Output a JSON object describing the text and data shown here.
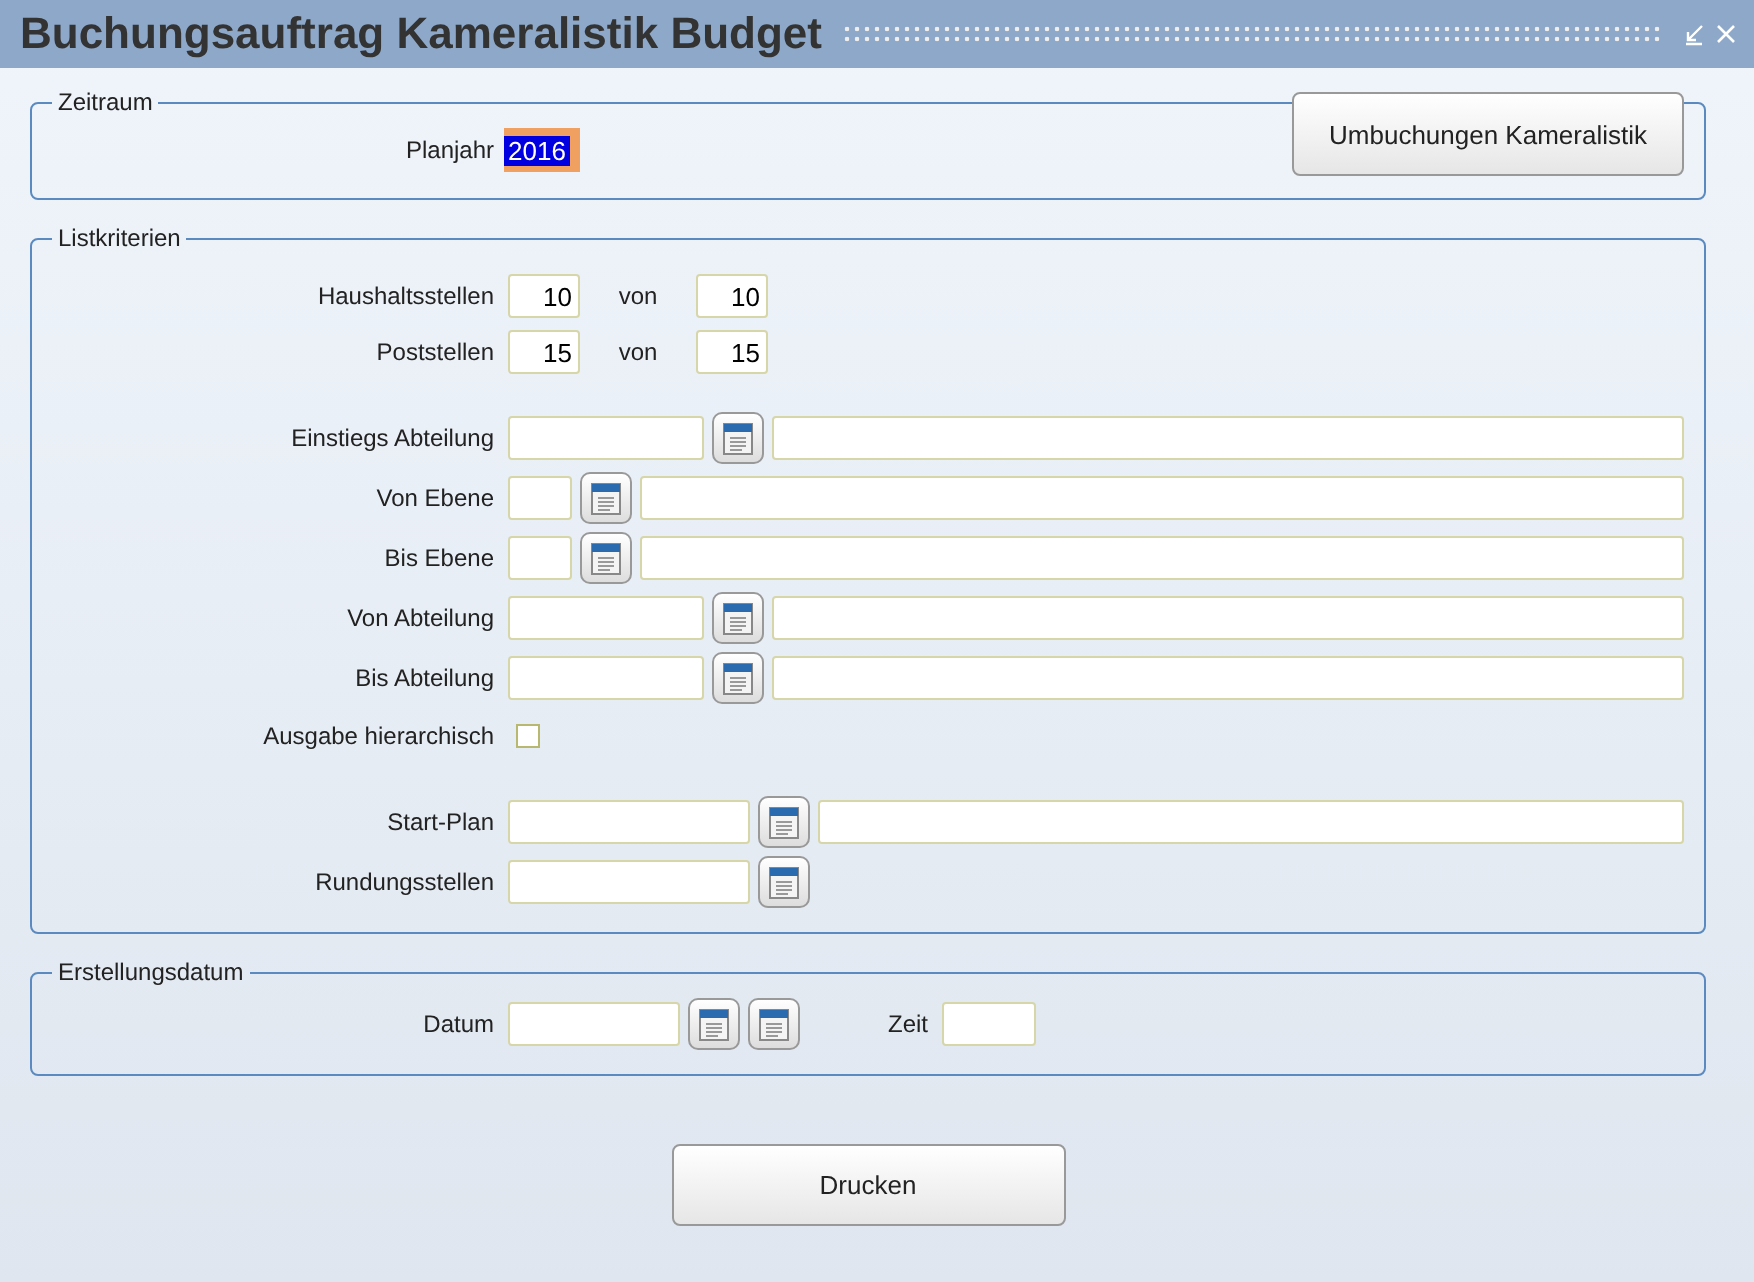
{
  "window": {
    "title": "Buchungsauftrag Kameralistik Budget"
  },
  "zeitraum": {
    "legend": "Zeitraum",
    "label": "Planjahr",
    "value": "2016",
    "selected": true,
    "button": "Umbuchungen Kameralistik"
  },
  "listkriterien": {
    "legend": "Listkriterien",
    "groups": [
      [
        {
          "kind": "range",
          "label": "Haushaltsstellen",
          "from": "10",
          "to_label": "von",
          "to": "10"
        },
        {
          "kind": "range",
          "label": "Poststellen",
          "from": "15",
          "to_label": "von",
          "to": "15"
        }
      ],
      [
        {
          "kind": "lookup",
          "label": "Einstiegs Abteilung",
          "has_description": true
        },
        {
          "kind": "short_lookup",
          "label": "Von Ebene",
          "has_description": true
        },
        {
          "kind": "short_lookup",
          "label": "Bis Ebene",
          "has_description": true
        },
        {
          "kind": "lookup",
          "label": "Von Abteilung",
          "has_description": true
        },
        {
          "kind": "lookup",
          "label": "Bis Abteilung",
          "has_description": true
        },
        {
          "kind": "checkbox",
          "label": "Ausgabe hierarchisch",
          "checked": false
        }
      ],
      [
        {
          "kind": "wide_lookup",
          "label": "Start-Plan",
          "has_description": true
        },
        {
          "kind": "wide_lookup",
          "label": "Rundungsstellen",
          "has_description": false
        }
      ]
    ]
  },
  "erstellungsdatum": {
    "legend": "Erstellungsdatum",
    "date_label": "Datum",
    "time_label": "Zeit"
  },
  "buttons": [
    "Drucken"
  ]
}
